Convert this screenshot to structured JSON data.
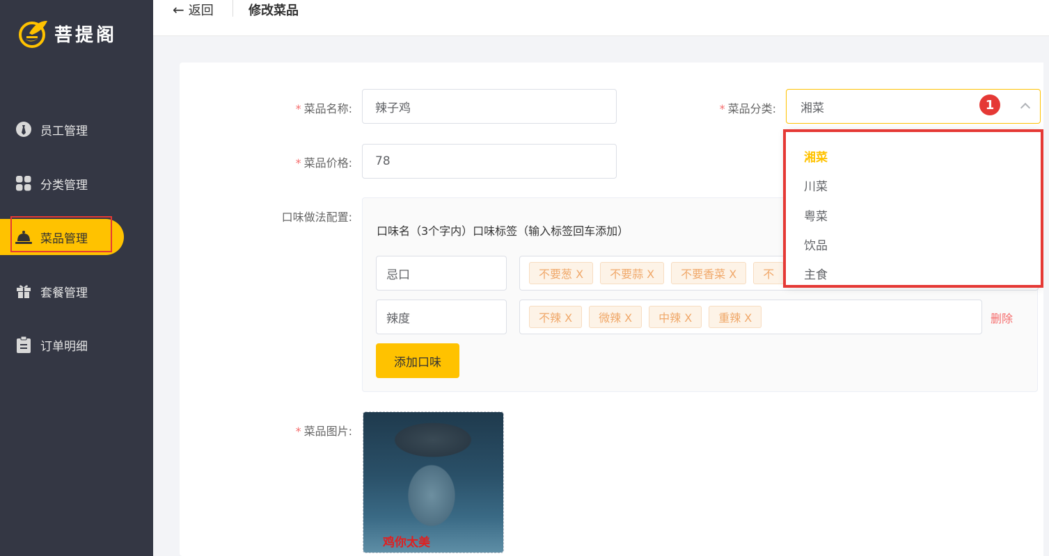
{
  "sidebar": {
    "logo_text": "菩提阁",
    "items": [
      {
        "label": "员工管理",
        "icon": "employee-icon"
      },
      {
        "label": "分类管理",
        "icon": "category-grid-icon"
      },
      {
        "label": "菜品管理",
        "icon": "dish-cloche-icon",
        "active": true
      },
      {
        "label": "套餐管理",
        "icon": "gift-icon"
      },
      {
        "label": "订单明细",
        "icon": "clipboard-icon"
      }
    ]
  },
  "header": {
    "back_label": "返回",
    "title": "修改菜品"
  },
  "form": {
    "name_label": "菜品名称:",
    "name_value": "辣子鸡",
    "category_label": "菜品分类:",
    "category_value": "湘菜",
    "price_label": "菜品价格:",
    "price_value": "78",
    "flavor_label": "口味做法配置:",
    "flavor_header": "口味名（3个字内）口味标签（输入标签回车添加）",
    "flavors": [
      {
        "name": "忌口",
        "tags": [
          "不要葱 X",
          "不要蒜 X",
          "不要香菜 X",
          "不"
        ]
      },
      {
        "name": "辣度",
        "tags": [
          "不辣 X",
          "微辣 X",
          "中辣 X",
          "重辣 X"
        ],
        "delete_label": "删除"
      }
    ],
    "add_flavor_label": "添加口味",
    "image_label": "菜品图片:",
    "image_caption": "鸡你太美"
  },
  "dropdown": {
    "annotation_badge": "1",
    "options": [
      "湘菜",
      "川菜",
      "粤菜",
      "饮品",
      "主食"
    ],
    "selected": "湘菜"
  },
  "colors": {
    "sidebar_bg": "#343744",
    "accent": "#ffc200",
    "annotation_red": "#e53935"
  }
}
